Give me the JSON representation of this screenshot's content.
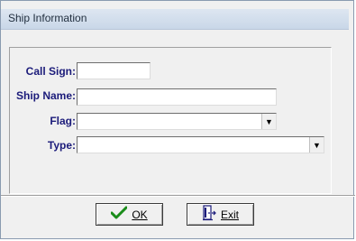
{
  "window": {
    "title": "Ship Information"
  },
  "form": {
    "call_sign": {
      "label": "Call Sign:",
      "value": ""
    },
    "ship_name": {
      "label": "Ship Name:",
      "value": ""
    },
    "flag": {
      "label": "Flag:",
      "value": ""
    },
    "type": {
      "label": "Type:",
      "value": ""
    }
  },
  "buttons": {
    "ok": {
      "label": "OK",
      "icon": "checkmark-icon"
    },
    "exit": {
      "label": "Exit",
      "icon": "exit-door-icon"
    }
  },
  "colors": {
    "label_text": "#1b1b7a",
    "checkmark": "#1a8c1a"
  }
}
